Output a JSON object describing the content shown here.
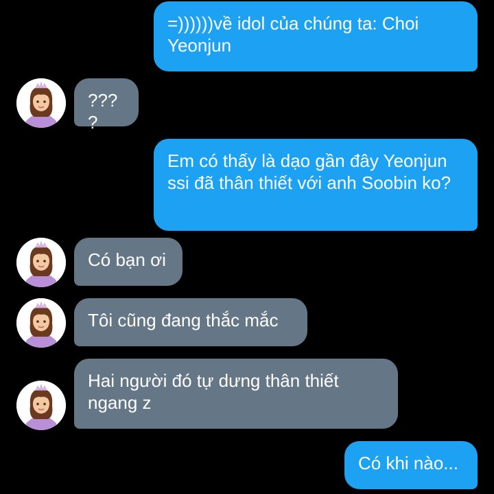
{
  "conversation": {
    "messages": [
      {
        "direction": "sent",
        "text": "=))))))về idol của chúng ta: Choi Yeonjun"
      },
      {
        "direction": "received",
        "text": "????",
        "avatar": "princess-avatar-icon"
      },
      {
        "direction": "sent",
        "text": "Em có thấy là dạo gần đây Yeonjun ssi đã thân thiết với anh Soobin ko?"
      },
      {
        "direction": "received",
        "text": "Có bạn ơi",
        "avatar": "princess-avatar-icon"
      },
      {
        "direction": "received",
        "text": "Tôi cũng đang thắc mắc",
        "avatar": "princess-avatar-icon"
      },
      {
        "direction": "received",
        "text": "Hai người đó tự dưng thân thiết ngang z",
        "avatar": "princess-avatar-icon"
      },
      {
        "direction": "sent",
        "text": "Có khi nào..."
      }
    ]
  },
  "colors": {
    "background": "#000000",
    "sent_bubble": "#1da1f2",
    "received_bubble": "#657786",
    "text": "#ffffff"
  }
}
